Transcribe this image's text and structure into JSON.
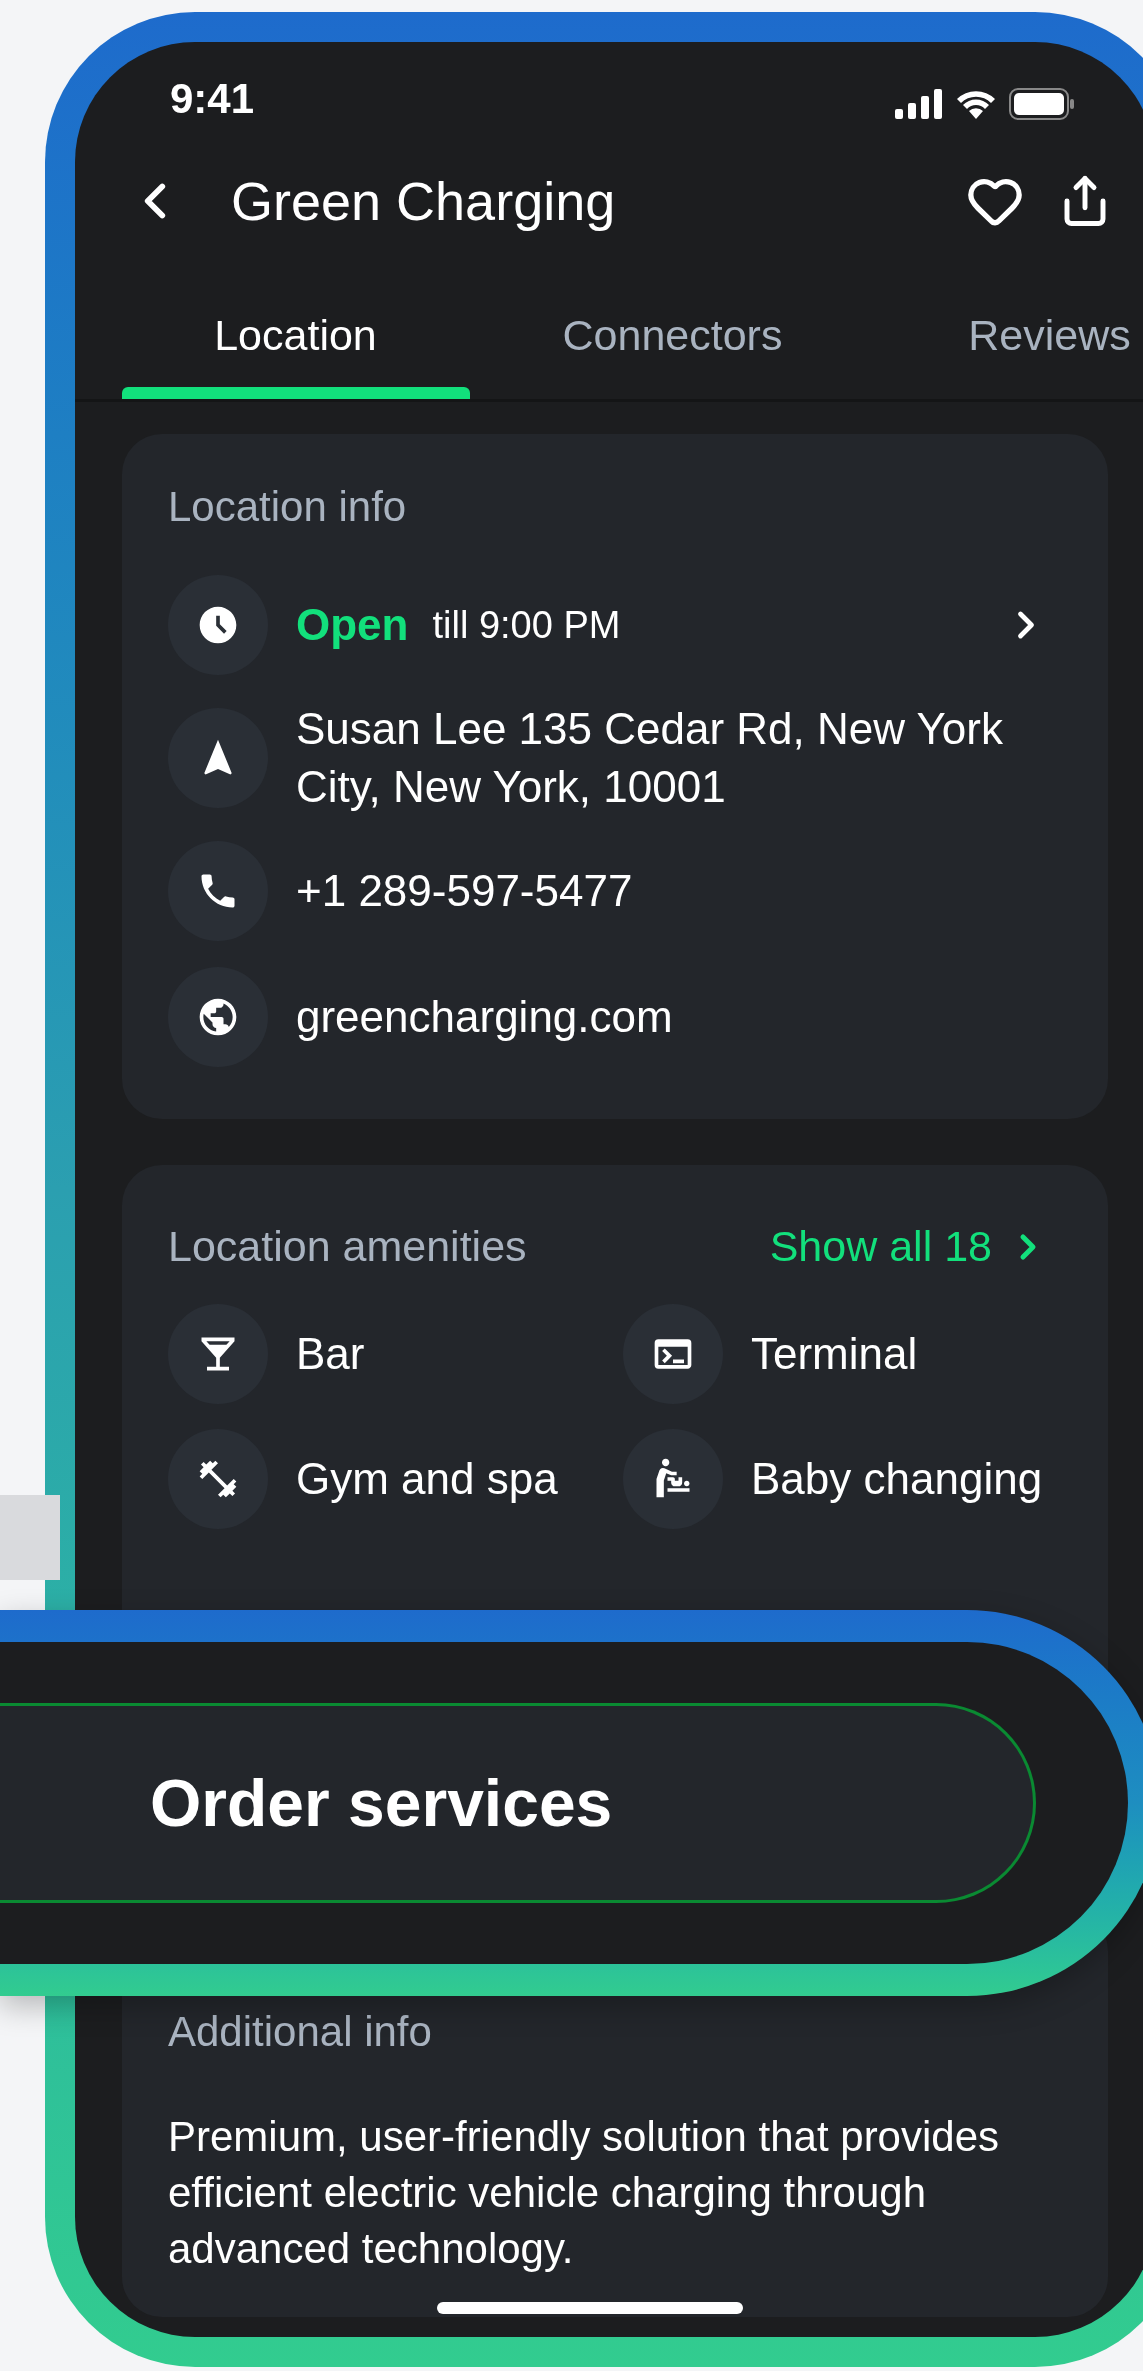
{
  "status_bar": {
    "time": "9:41"
  },
  "header": {
    "title": "Green Charging"
  },
  "tabs": [
    {
      "label": "Location",
      "selected": true
    },
    {
      "label": "Connectors",
      "selected": false
    },
    {
      "label": "Reviews",
      "selected": false
    }
  ],
  "location_info": {
    "title": "Location info",
    "rows": [
      {
        "kind": "hours",
        "status": "Open",
        "detail": "till 9:00 PM"
      },
      {
        "kind": "address",
        "text": "Susan Lee 135 Cedar Rd, New York City, New York, 10001"
      },
      {
        "kind": "phone",
        "text": "+1 289-597-5477"
      },
      {
        "kind": "website",
        "text": "greencharging.com"
      }
    ]
  },
  "amenities": {
    "title": "Location amenities",
    "link": "Show all 18",
    "items": [
      {
        "kind": "bar",
        "label": "Bar"
      },
      {
        "kind": "terminal",
        "label": "Terminal"
      },
      {
        "kind": "gym",
        "label": "Gym and spa"
      },
      {
        "kind": "baby",
        "label": "Baby changing"
      }
    ]
  },
  "order_button": {
    "label": "Order services"
  },
  "additional_info": {
    "title": "Additional info",
    "text": "Premium, user-friendly solution that provides efficient electric vehicle charging through advanced technology."
  }
}
